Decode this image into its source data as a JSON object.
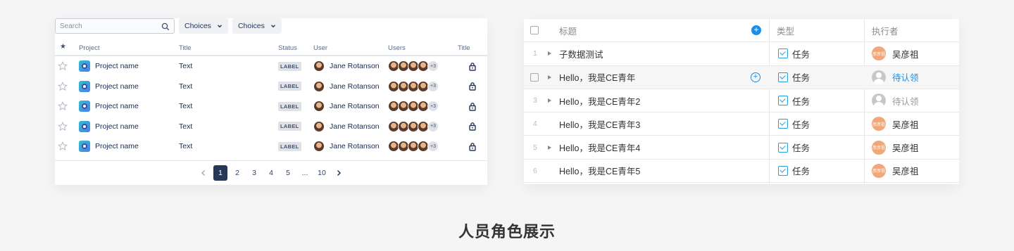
{
  "left": {
    "search": {
      "placeholder": "Search"
    },
    "filters": [
      "Choices",
      "Choices"
    ],
    "columns": {
      "star": "★",
      "project": "Project",
      "title": "Title",
      "status": "Status",
      "user": "User",
      "users": "Users",
      "title2": "Title"
    },
    "rows": [
      {
        "project": "Project name",
        "title": "Text",
        "status": "LABEL",
        "user": "Jane Rotanson",
        "more": "+3"
      },
      {
        "project": "Project name",
        "title": "Text",
        "status": "LABEL",
        "user": "Jane Rotanson",
        "more": "+3"
      },
      {
        "project": "Project name",
        "title": "Text",
        "status": "LABEL",
        "user": "Jane Rotanson",
        "more": "+3"
      },
      {
        "project": "Project name",
        "title": "Text",
        "status": "LABEL",
        "user": "Jane Rotanson",
        "more": "+3"
      },
      {
        "project": "Project name",
        "title": "Text",
        "status": "LABEL",
        "user": "Jane Rotanson",
        "more": "+3"
      }
    ],
    "pagination": {
      "pages": [
        "1",
        "2",
        "3",
        "4",
        "5",
        "...",
        "10"
      ],
      "current": "1"
    }
  },
  "right": {
    "columns": {
      "title": "标题",
      "type": "类型",
      "assignee": "执行者"
    },
    "rows": [
      {
        "num": "1",
        "title": "子数据测试",
        "type": "任务",
        "avatar": "彦彦祖",
        "assignee": "吴彦祖"
      },
      {
        "num": "",
        "title": "Hello，我是CE青年",
        "type": "任务",
        "assignee": "待认领"
      },
      {
        "num": "3",
        "title": "Hello，我是CE青年2",
        "type": "任务",
        "assignee": "待认领"
      },
      {
        "num": "4",
        "title": "Hello，我是CE青年3",
        "type": "任务",
        "avatar": "彦彦祖",
        "assignee": "吴彦祖"
      },
      {
        "num": "5",
        "title": "Hello，我是CE青年4",
        "type": "任务",
        "avatar": "彦彦祖",
        "assignee": "吴彦祖"
      },
      {
        "num": "6",
        "title": "Hello，我是CE青年5",
        "type": "任务",
        "avatar": "彦彦祖",
        "assignee": "吴彦祖"
      }
    ]
  },
  "caption": "人员角色展示",
  "colors": {
    "accent": "#1a8ee8",
    "pager_active": "#253858",
    "avatar_orange": "#f0a878"
  }
}
